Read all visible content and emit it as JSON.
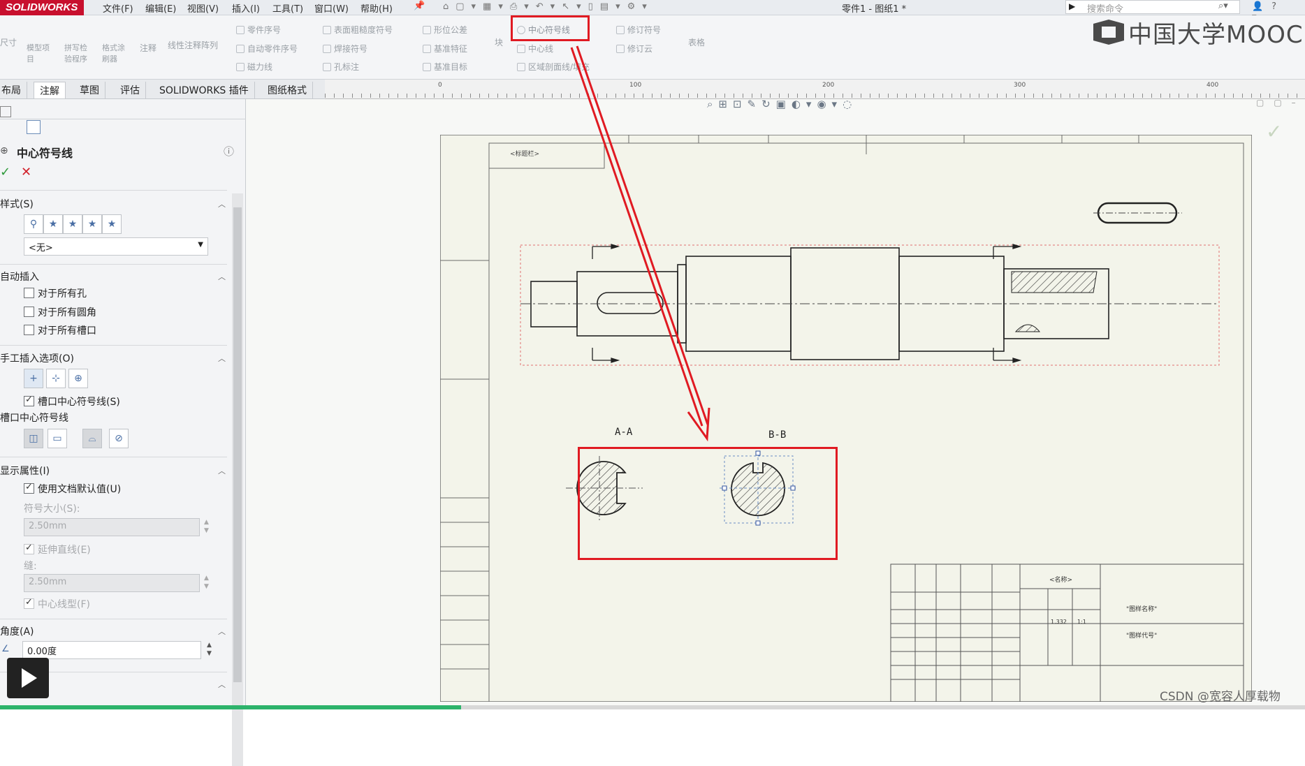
{
  "app": {
    "logo": "SOLIDWORKS",
    "document_title": "零件1 - 图纸1 *"
  },
  "menu": [
    "文件(F)",
    "编辑(E)",
    "视图(V)",
    "插入(I)",
    "工具(T)",
    "窗口(W)",
    "帮助(H)"
  ],
  "search": {
    "placeholder": "搜索命令"
  },
  "ribbon": {
    "left_tools": [
      "尺寸",
      "模型项目",
      "拼写检验程序",
      "格式涂刷器",
      "注释",
      "线性注释阵列"
    ],
    "col1": [
      "零件序号",
      "自动零件序号",
      "磁力线"
    ],
    "col2": [
      "表面粗糙度符号",
      "焊接符号",
      "孔标注"
    ],
    "col3": [
      "形位公差",
      "基准特征",
      "基准目标"
    ],
    "col4": [
      "块"
    ],
    "col5": [
      "中心符号线",
      "中心线",
      "区域剖面线/填充"
    ],
    "col6": [
      "修订符号",
      "修订云"
    ],
    "col7": [
      "表格"
    ]
  },
  "tabs": [
    "布局",
    "注解",
    "草图",
    "评估",
    "SOLIDWORKS 插件",
    "图纸格式"
  ],
  "active_tab": "注解",
  "ruler_numbers": [
    "0",
    "100",
    "200",
    "300",
    "400"
  ],
  "panel": {
    "title": "中心符号线",
    "sections": {
      "style": "样式(S)",
      "style_value": "<无>",
      "auto_insert": "自动插入",
      "auto_items": [
        "对于所有孔",
        "对于所有圆角",
        "对于所有槽口"
      ],
      "manual": "手工插入选项(O)",
      "slot_center": "槽口中心符号线(S)",
      "slot_label": "槽口中心符号线",
      "display": "显示属性(I)",
      "use_doc_default": "使用文档默认值(U)",
      "mark_size_label": "符号大小(S):",
      "mark_size": "2.50mm",
      "extend_lines": "延伸直线(E)",
      "gap_label": "缝:",
      "gap": "2.50mm",
      "centerline_type": "中心线型(F)",
      "angle": "角度(A)",
      "angle_value": "0.00度"
    }
  },
  "drawing": {
    "title_box": "<标题栏>",
    "section_a": "A-A",
    "section_b": "B-B",
    "titleblock_name": "<名称>",
    "titleblock_material": "\"图样名称\"",
    "titleblock_code": "\"图样代号\"",
    "titleblock_scale": "1:1",
    "titleblock_weight": "1.332"
  },
  "overlay": {
    "mooc": "中国大学MOOC",
    "watermark": "CSDN @宽容人厚载物"
  },
  "colors": {
    "highlight_red": "#e01a22",
    "logo_red": "#c8102e",
    "sheet": "#f3f4ea",
    "progress": "#2db36b"
  }
}
